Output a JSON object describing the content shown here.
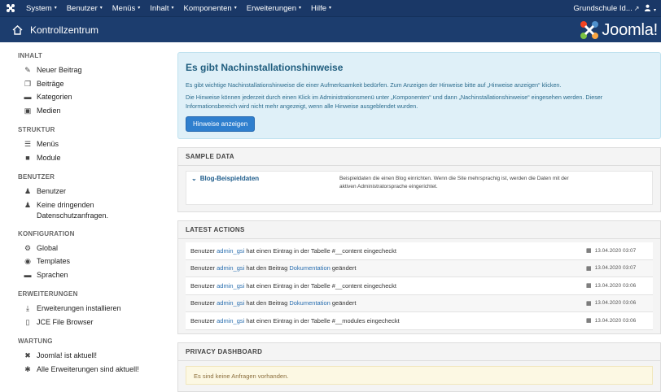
{
  "menubar": {
    "items": [
      "System",
      "Benutzer",
      "Menüs",
      "Inhalt",
      "Komponenten",
      "Erweiterungen",
      "Hilfe"
    ],
    "site_name": "Grundschule Id...",
    "user_icon": "user-icon"
  },
  "header": {
    "title": "Kontrollzentrum",
    "brand": "Joomla!"
  },
  "sidebar": {
    "sections": [
      {
        "title": "INHALT",
        "items": [
          {
            "icon": "pencil-icon",
            "label": "Neuer Beitrag"
          },
          {
            "icon": "copy-icon",
            "label": "Beiträge"
          },
          {
            "icon": "folder-icon",
            "label": "Kategorien"
          },
          {
            "icon": "image-icon",
            "label": "Medien"
          }
        ]
      },
      {
        "title": "STRUKTUR",
        "items": [
          {
            "icon": "list-icon",
            "label": "Menüs"
          },
          {
            "icon": "cube-icon",
            "label": "Module"
          }
        ]
      },
      {
        "title": "BENUTZER",
        "items": [
          {
            "icon": "users-icon",
            "label": "Benutzer"
          },
          {
            "icon": "users-icon",
            "label": "Keine dringenden Datenschutzanfragen."
          }
        ]
      },
      {
        "title": "KONFIGURATION",
        "items": [
          {
            "icon": "gear-icon",
            "label": "Global"
          },
          {
            "icon": "eye-icon",
            "label": "Templates"
          },
          {
            "icon": "comments-icon",
            "label": "Sprachen"
          }
        ]
      },
      {
        "title": "ERWEITERUNGEN",
        "items": [
          {
            "icon": "download-icon",
            "label": "Erweiterungen installieren"
          },
          {
            "icon": "file-icon",
            "label": "JCE File Browser"
          }
        ]
      },
      {
        "title": "WARTUNG",
        "items": [
          {
            "icon": "joomla-icon",
            "label": "Joomla! ist aktuell!"
          },
          {
            "icon": "asterisk-icon",
            "label": "Alle Erweiterungen sind aktuell!"
          }
        ]
      }
    ]
  },
  "alert": {
    "title": "Es gibt Nachinstallationshinweise",
    "p1": "Es gibt wichtige Nachinstallationshinweise die einer Aufmerksamkeit bedürfen. Zum Anzeigen der Hinweise bitte auf „Hinweise anzeigen“ klicken.",
    "p2": "Die Hinweise können jederzeit durch einen Klick im Administrationsmenü unter „Komponenten“ und dann „Nachinstallationshinweise“ eingesehen werden. Dieser Informationsbereich wird nicht mehr angezeigt, wenn alle Hinweise ausgeblendet wurden.",
    "button": "Hinweise anzeigen"
  },
  "sample_data": {
    "heading": "SAMPLE DATA",
    "name": "Blog-Beispieldaten",
    "description": "Beispieldaten die einen Blog einrichten. Wenn die Site mehrsprachig ist, werden die Daten mit der aktiven Administratorsprache eingerichtet."
  },
  "latest_actions": {
    "heading": "LATEST ACTIONS",
    "rows": [
      {
        "pre": "Benutzer ",
        "link": "admin_gsi",
        "mid": " hat einen Eintrag in der Tabelle #__content eingecheckt",
        "link2": "",
        "post": "",
        "date": "13.04.2020 03:07"
      },
      {
        "pre": "Benutzer ",
        "link": "admin_gsi",
        "mid": " hat den Beitrag ",
        "link2": "Dokumentation",
        "post": " geändert",
        "date": "13.04.2020 03:07"
      },
      {
        "pre": "Benutzer ",
        "link": "admin_gsi",
        "mid": " hat einen Eintrag in der Tabelle #__content eingecheckt",
        "link2": "",
        "post": "",
        "date": "13.04.2020 03:06"
      },
      {
        "pre": "Benutzer ",
        "link": "admin_gsi",
        "mid": " hat den Beitrag ",
        "link2": "Dokumentation",
        "post": " geändert",
        "date": "13.04.2020 03:06"
      },
      {
        "pre": "Benutzer ",
        "link": "admin_gsi",
        "mid": " hat einen Eintrag in der Tabelle #__modules eingecheckt",
        "link2": "",
        "post": "",
        "date": "13.04.2020 03:06"
      }
    ]
  },
  "privacy": {
    "heading": "PRIVACY DASHBOARD",
    "message": "Es sind keine Anfragen vorhanden."
  },
  "colors": {
    "menubar": "#1a3867",
    "header": "#1c3d6e",
    "alert_bg": "#dff0f8",
    "button": "#2f7fce",
    "link": "#2a6fb0"
  }
}
